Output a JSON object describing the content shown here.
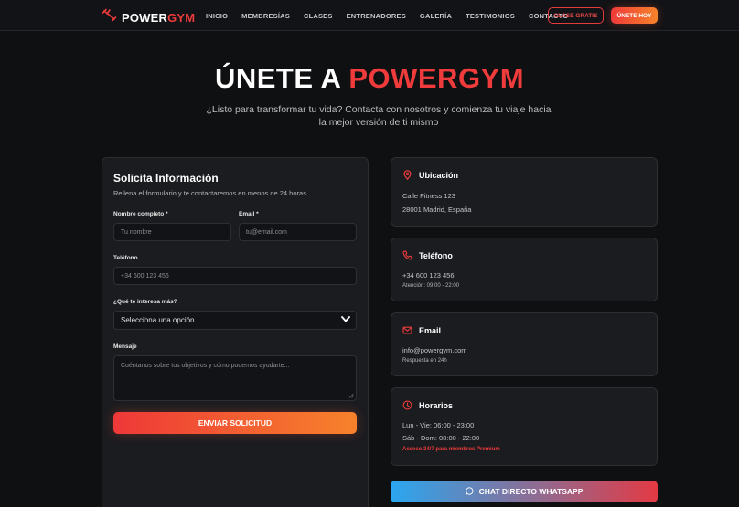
{
  "brand": {
    "name_white": "POWER",
    "name_red": "GYM"
  },
  "nav": {
    "links": [
      "INICIO",
      "MEMBRESÍAS",
      "CLASES",
      "ENTRENADORES",
      "GALERÍA",
      "TESTIMONIOS",
      "CONTACTO"
    ],
    "trial_button": "CLASE GRATIS",
    "join_button": "ÚNETE HOY"
  },
  "hero": {
    "title_white": "ÚNETE A ",
    "title_red": "POWERGYM",
    "subtitle": "¿Listo para transformar tu vida? Contacta con nosotros y comienza tu viaje hacia la mejor versión de ti mismo"
  },
  "form": {
    "title": "Solicita Información",
    "subtitle": "Rellena el formulario y te contactaremos en menos de 24 horas",
    "name_label": "Nombre completo *",
    "name_placeholder": "Tu nombre",
    "email_label": "Email *",
    "email_placeholder": "tu@email.com",
    "phone_label": "Teléfono",
    "phone_placeholder": "+34 600 123 456",
    "interest_label": "¿Qué te interesa más?",
    "interest_selected": "Selecciona una opción",
    "message_label": "Mensaje",
    "message_placeholder": "Cuéntanos sobre tus objetivos y cómo podemos ayudarte...",
    "submit": "ENVIAR SOLICITUD"
  },
  "info": {
    "location": {
      "title": "Ubicación",
      "line1": "Calle Fitness 123",
      "line2": "28001 Madrid, España"
    },
    "phone": {
      "title": "Teléfono",
      "number": "+34 600 123 456",
      "hours": "Atención: 09:00 - 22:00"
    },
    "email": {
      "title": "Email",
      "address": "info@powergym.com",
      "note": "Respuesta en 24h"
    },
    "schedule": {
      "title": "Horarios",
      "weekdays": "Lun - Vie: 06:00 - 23:00",
      "weekend": "Sáb - Dom: 08:00 - 22:00",
      "premium": "Acceso 24/7 para miembros Premium"
    }
  },
  "whatsapp_button": "CHAT DIRECTO WHATSAPP",
  "colors": {
    "accent_red": "#ef3b3b",
    "accent_orange": "#f7832a",
    "whatsapp_blue": "#2aa7f0",
    "background": "#0f1012",
    "card": "#1b1c20"
  }
}
